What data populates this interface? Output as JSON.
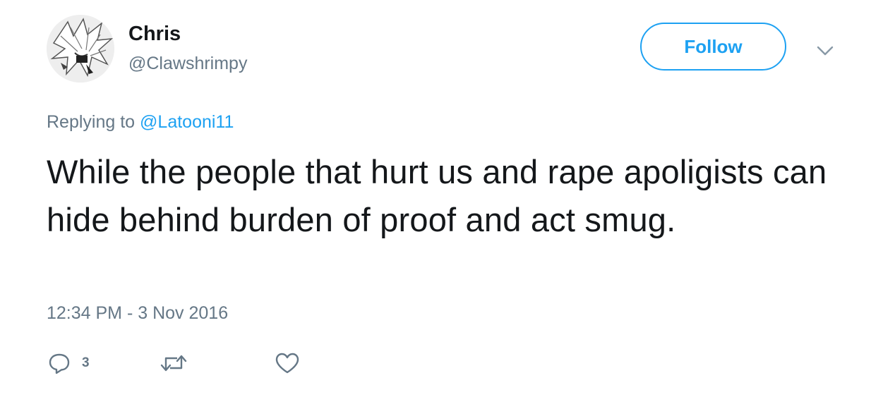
{
  "user": {
    "display_name": "Chris",
    "handle": "@Clawshrimpy"
  },
  "follow_button": {
    "label": "Follow"
  },
  "reply_context": {
    "prefix": "Replying to",
    "mention": "@Latooni11"
  },
  "tweet": {
    "text": "While the people that hurt us and rape apoligists can hide behind burden of proof and act smug.",
    "timestamp": "12:34 PM - 3 Nov 2016"
  },
  "actions": {
    "reply": {
      "icon": "reply-icon",
      "count": "3"
    },
    "retweet": {
      "icon": "retweet-icon"
    },
    "like": {
      "icon": "heart-icon"
    }
  },
  "colors": {
    "accent": "#1da1f2",
    "secondary_text": "#657786",
    "primary_text": "#14171a"
  }
}
